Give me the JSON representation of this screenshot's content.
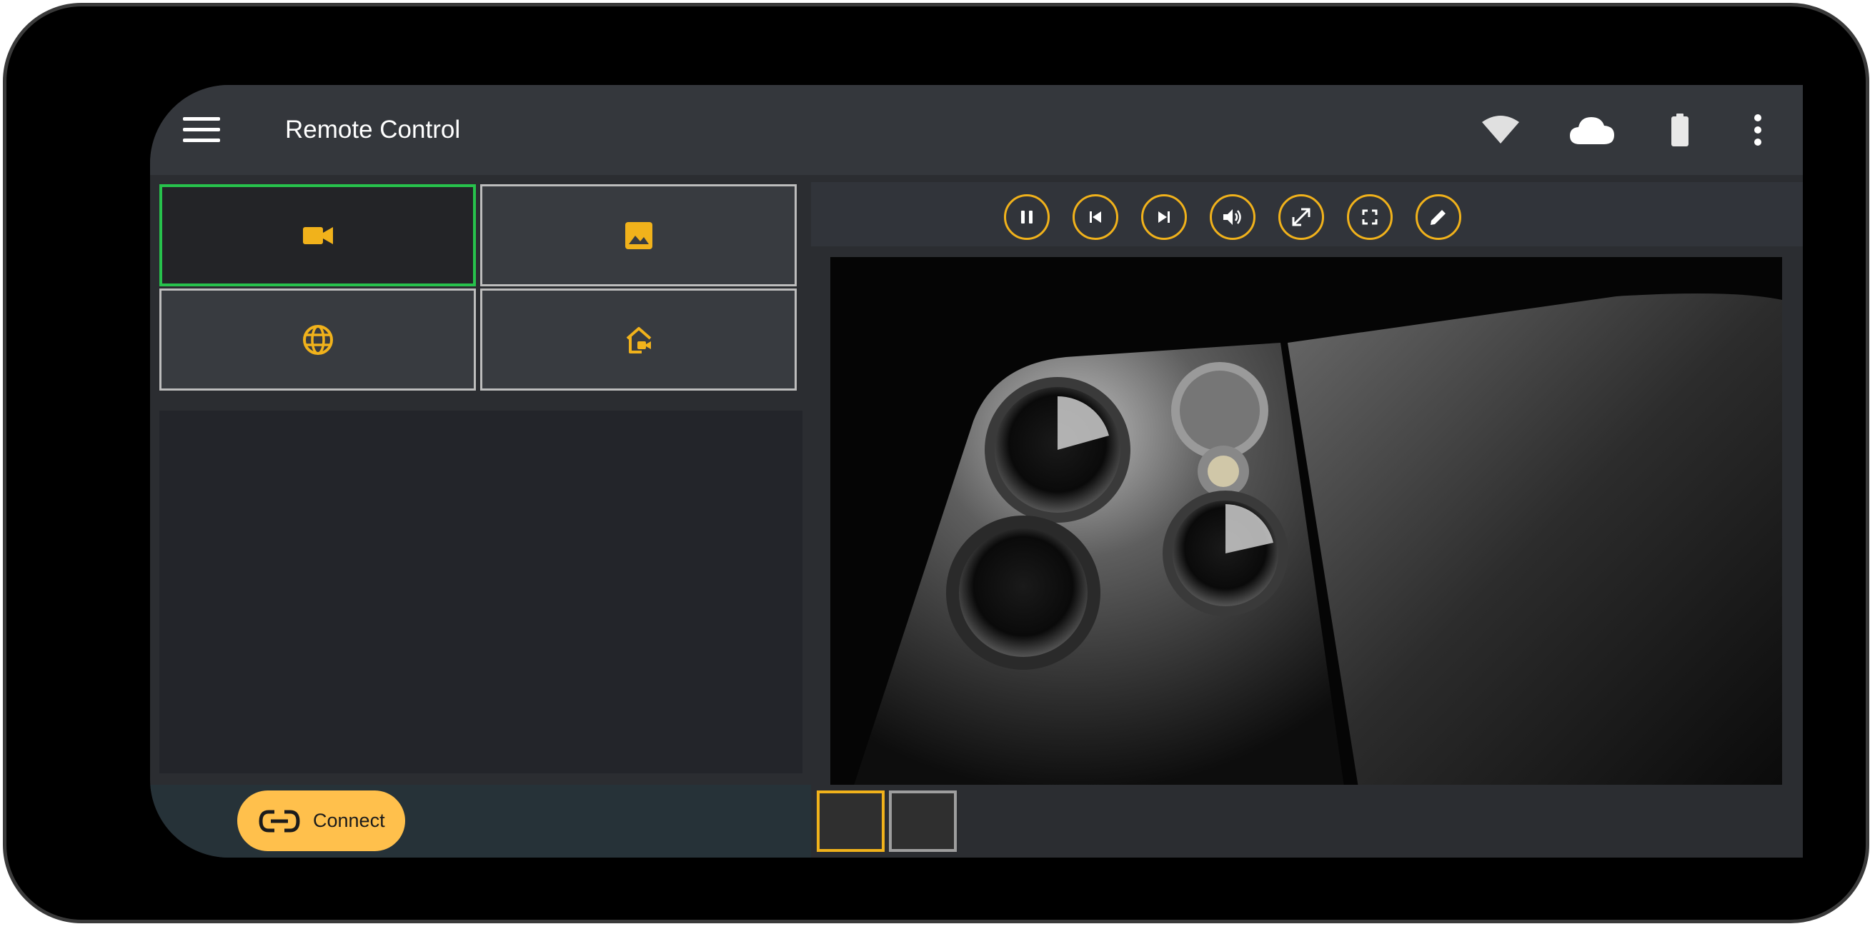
{
  "app": {
    "title": "Remote Control"
  },
  "appbar_icons": [
    "menu-icon",
    "wifi-icon",
    "cloud-icon",
    "battery-icon",
    "more-vert-icon"
  ],
  "source_tiles": [
    {
      "icon": "videocam-icon",
      "selected": true
    },
    {
      "icon": "image-icon",
      "selected": false
    },
    {
      "icon": "globe-icon",
      "selected": false
    },
    {
      "icon": "home-camera-icon",
      "selected": false
    }
  ],
  "player_controls": [
    "pause-icon",
    "skip-previous-icon",
    "skip-next-icon",
    "volume-icon",
    "expand-icon",
    "fullscreen-icon",
    "edit-icon"
  ],
  "connect": {
    "label": "Connect",
    "icon": "link-icon"
  },
  "thumbnails": [
    {
      "active": true
    },
    {
      "active": false
    }
  ],
  "colors": {
    "accent": "#f1b21b",
    "selected_border": "#27c24c",
    "connect_button": "#ffc04c",
    "appbar": "#34373c",
    "background": "#2b2d31"
  }
}
